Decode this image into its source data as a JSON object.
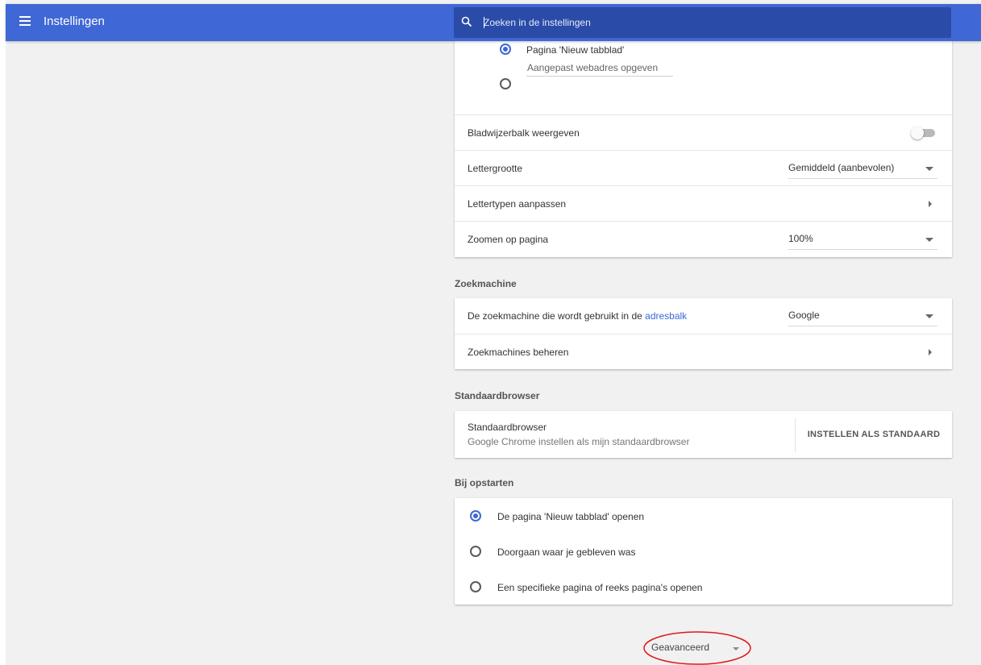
{
  "header": {
    "title": "Instellingen",
    "search_placeholder": "Zoeken in de instellingen"
  },
  "appearance": {
    "new_tab_option": "Pagina 'Nieuw tabblad'",
    "custom_url_placeholder": "Aangepast webadres opgeven",
    "bookmarks_bar_label": "Bladwijzerbalk weergeven",
    "bookmarks_bar_enabled": false,
    "font_size_label": "Lettergrootte",
    "font_size_value": "Gemiddeld (aanbevolen)",
    "customize_fonts_label": "Lettertypen aanpassen",
    "page_zoom_label": "Zoomen op pagina",
    "page_zoom_value": "100%"
  },
  "search_engine": {
    "section_title": "Zoekmachine",
    "engine_label_prefix": "De zoekmachine die wordt gebruikt in de",
    "engine_label_link": "adresbalk",
    "engine_value": "Google",
    "manage_label": "Zoekmachines beheren"
  },
  "default_browser": {
    "section_title": "Standaardbrowser",
    "title": "Standaardbrowser",
    "subtitle": "Google Chrome instellen als mijn standaardbrowser",
    "button_label": "INSTELLEN ALS STANDAARD"
  },
  "on_startup": {
    "section_title": "Bij opstarten",
    "options": [
      "De pagina 'Nieuw tabblad' openen",
      "Doorgaan waar je gebleven was",
      "Een specifieke pagina of reeks pagina's openen"
    ],
    "selected_index": 0
  },
  "advanced": {
    "label": "Geavanceerd"
  },
  "colors": {
    "accent": "#3f67d5",
    "header_bg": "#3f67d5",
    "search_bg": "#2a4ca8",
    "page_bg": "#f1f1f1",
    "annotation_red": "#e0181b"
  }
}
